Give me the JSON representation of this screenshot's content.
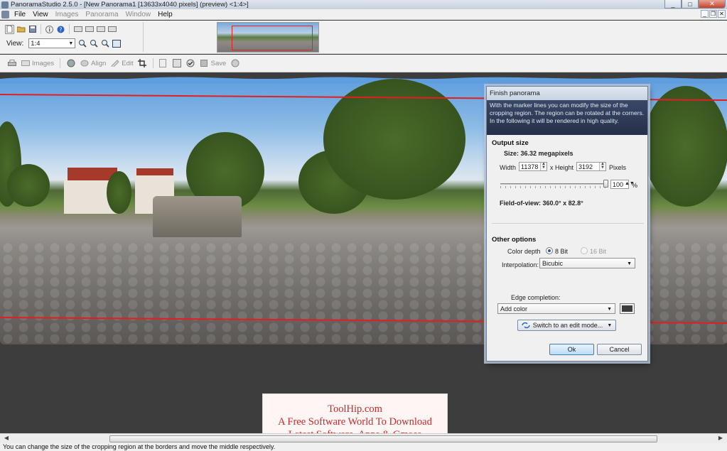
{
  "window": {
    "title": "PanoramaStudio 2.5.0 - [New Panorama1 [13633x4040 pixels] (preview) <1:4>]",
    "btn_min": "_",
    "btn_max": "□",
    "btn_close": "✕"
  },
  "menu": {
    "items": [
      "File",
      "View",
      "Images",
      "Panorama",
      "Window",
      "Help"
    ],
    "mdi_min": "_",
    "mdi_restore": "❐",
    "mdi_close": "✕"
  },
  "toolbar": {
    "view_label": "View:",
    "view_value": "1:4"
  },
  "toolbar2": {
    "images": "Images",
    "align": "Align",
    "edit": "Edit",
    "save": "Save"
  },
  "dialog": {
    "title": "Finish panorama",
    "help_text": "With the marker lines you can modify the size of the cropping region. The region can be rotated at the corners. In the following it will be rendered in high quality.",
    "output_size_title": "Output size",
    "size_text": "Size: 36.32 megapixels",
    "width_label": "Width",
    "width_value": "11378",
    "height_label": "x Height",
    "height_value": "3192",
    "pixels_label": "Pixels",
    "percent_value": "100",
    "percent_unit": "%",
    "slider_level": 1.0,
    "fov_text": "Field-of-view: 360.0° x 82.8°",
    "other_options_title": "Other options",
    "color_depth_label": "Color depth",
    "bit8_label": "8 Bit",
    "bit16_label": "16 Bit",
    "interpolation_label": "Interpolation:",
    "interpolation_value": "Bicubic",
    "edge_label": "Edge completion:",
    "edge_value": "Add color",
    "edit_mode_label": "Switch to an edit mode...",
    "ok_label": "Ok",
    "cancel_label": "Cancel",
    "edge_color": "#3c3c3c"
  },
  "watermark": {
    "line1": "ToolHip.com",
    "line2": "A Free Software World To Download",
    "line3": "Latest Software, Apps & Gmaes"
  },
  "status": {
    "text": "You can change the size of the cropping region at the borders and move the middle respectively."
  },
  "colors": {
    "crop_line": "#e02020",
    "canvas_bg": "#3d3d3d"
  }
}
